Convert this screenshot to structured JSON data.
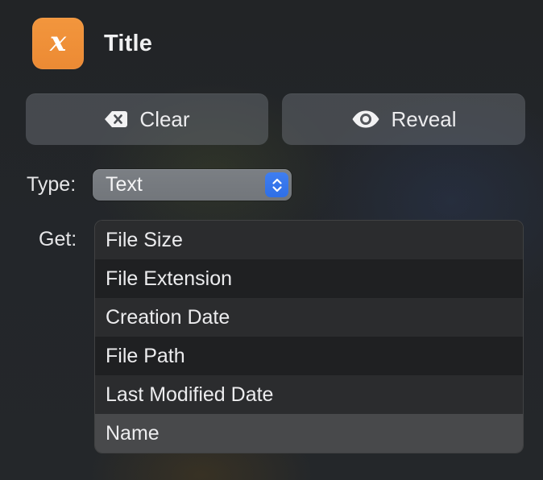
{
  "header": {
    "icon_glyph": "x",
    "icon_color": "#F0903A",
    "title": "Title"
  },
  "actions": {
    "clear": {
      "label": "Clear",
      "icon": "delete-left-icon"
    },
    "reveal": {
      "label": "Reveal",
      "icon": "eye-icon"
    }
  },
  "type_row": {
    "label": "Type:",
    "selected": "Text",
    "accent": "#3478F6"
  },
  "get_row": {
    "label": "Get:",
    "items": [
      {
        "label": "File Size"
      },
      {
        "label": "File Extension"
      },
      {
        "label": "Creation Date"
      },
      {
        "label": "File Path"
      },
      {
        "label": "Last Modified Date"
      },
      {
        "label": "Name",
        "selected": true
      }
    ]
  }
}
